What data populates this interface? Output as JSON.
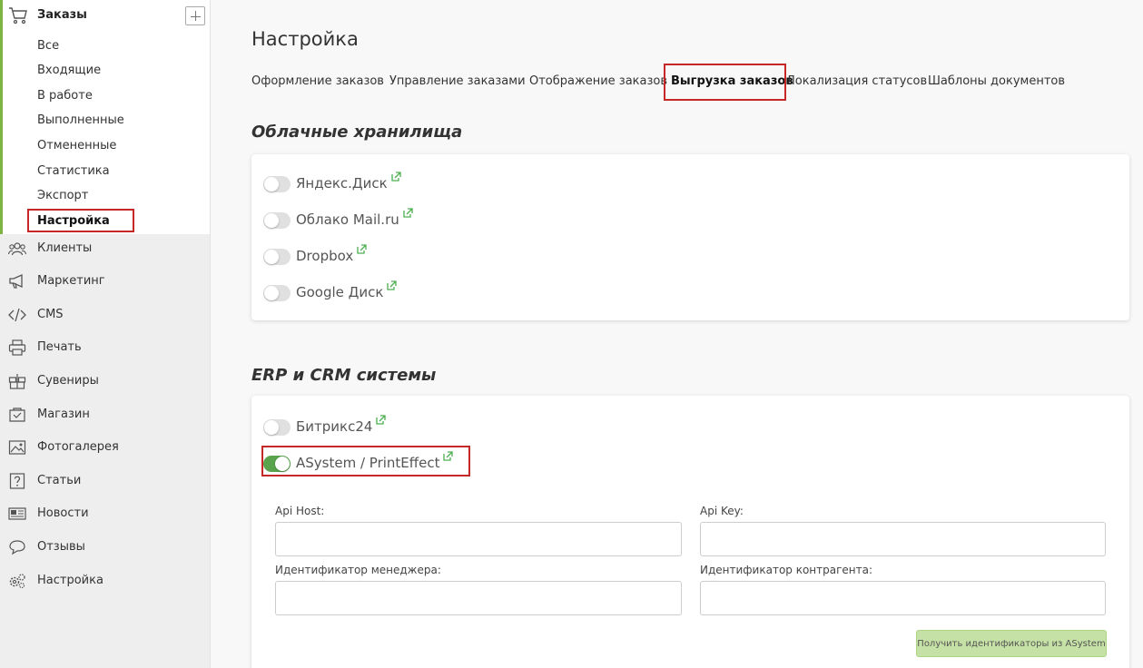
{
  "sidebar": {
    "orders": {
      "title": "Заказы",
      "items": [
        "Все",
        "Входящие",
        "В работе",
        "Выполненные",
        "Отмененные",
        "Статистика",
        "Экспорт",
        "Настройка"
      ]
    },
    "nav": [
      {
        "label": "Клиенты",
        "icon": "users-icon"
      },
      {
        "label": "Маркетинг",
        "icon": "megaphone-icon"
      },
      {
        "label": "CMS",
        "icon": "code-icon"
      },
      {
        "label": "Печать",
        "icon": "printer-icon"
      },
      {
        "label": "Сувениры",
        "icon": "gift-icon"
      },
      {
        "label": "Магазин",
        "icon": "shop-icon"
      },
      {
        "label": "Фотогалерея",
        "icon": "image-icon"
      },
      {
        "label": "Статьи",
        "icon": "question-icon"
      },
      {
        "label": "Новости",
        "icon": "newspaper-icon"
      },
      {
        "label": "Отзывы",
        "icon": "chat-icon"
      },
      {
        "label": "Настройка",
        "icon": "gears-icon"
      }
    ]
  },
  "main": {
    "title": "Настройка",
    "tabs": [
      "Оформление заказов",
      "Управление заказами",
      "Отображение заказов",
      "Выгрузка заказов",
      "Локализация статусов",
      "Шаблоны документов"
    ],
    "active_tab": "Выгрузка заказов",
    "cloud": {
      "title": "Облачные хранилища",
      "items": [
        {
          "name": "Яндекс.Диск",
          "enabled": false
        },
        {
          "name": "Облако Mail.ru",
          "enabled": false
        },
        {
          "name": "Dropbox",
          "enabled": false
        },
        {
          "name": "Google Диск",
          "enabled": false
        }
      ]
    },
    "erp": {
      "title": "ERP и CRM системы",
      "items": [
        {
          "name": "Битрикс24",
          "enabled": false
        },
        {
          "name": "ASystem / PrintEffect",
          "enabled": true
        }
      ],
      "fields": {
        "api_host": {
          "label": "Api Host:",
          "value": ""
        },
        "api_key": {
          "label": "Api Key:",
          "value": ""
        },
        "manager_id": {
          "label": "Идентификатор менеджера:",
          "value": ""
        },
        "contractor_id": {
          "label": "Идентификатор контрагента:",
          "value": ""
        }
      },
      "fetch_button": "Получить идентификаторы из ASystem"
    }
  },
  "colors": {
    "accent_green": "#7cb342",
    "toggle_on": "#5aa34d",
    "highlight_red": "#c62828",
    "link_icon": "#4caf50"
  }
}
